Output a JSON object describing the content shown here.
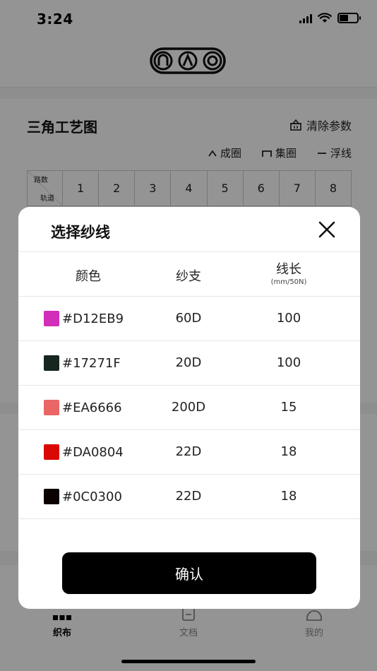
{
  "status": {
    "time": "3:24"
  },
  "page": {
    "title": "三角工艺图",
    "clear_label": "清除参数",
    "legend": [
      {
        "label": "成圈"
      },
      {
        "label": "集圈"
      },
      {
        "label": "浮线"
      }
    ],
    "grid": {
      "corner_top": "路数",
      "corner_bottom": "轨道",
      "columns": [
        "1",
        "2",
        "3",
        "4",
        "5",
        "6",
        "7",
        "8"
      ]
    }
  },
  "tabs": [
    {
      "label": "织布"
    },
    {
      "label": "文档"
    },
    {
      "label": "我的"
    }
  ],
  "modal": {
    "title": "选择纱线",
    "headers": {
      "color": "颜色",
      "count": "纱支",
      "length": "线长",
      "length_unit": "(mm/50N)"
    },
    "rows": [
      {
        "hex": "#D12EB9",
        "count": "60D",
        "length": "100"
      },
      {
        "hex": "#17271F",
        "count": "20D",
        "length": "100"
      },
      {
        "hex": "#EA6666",
        "count": "200D",
        "length": "15"
      },
      {
        "hex": "#DA0804",
        "count": "22D",
        "length": "18"
      },
      {
        "hex": "#0C0300",
        "count": "22D",
        "length": "18"
      }
    ],
    "confirm_label": "确认"
  },
  "colors": {
    "overlay": "rgba(0,0,0,0.42)",
    "button": "#000000"
  }
}
